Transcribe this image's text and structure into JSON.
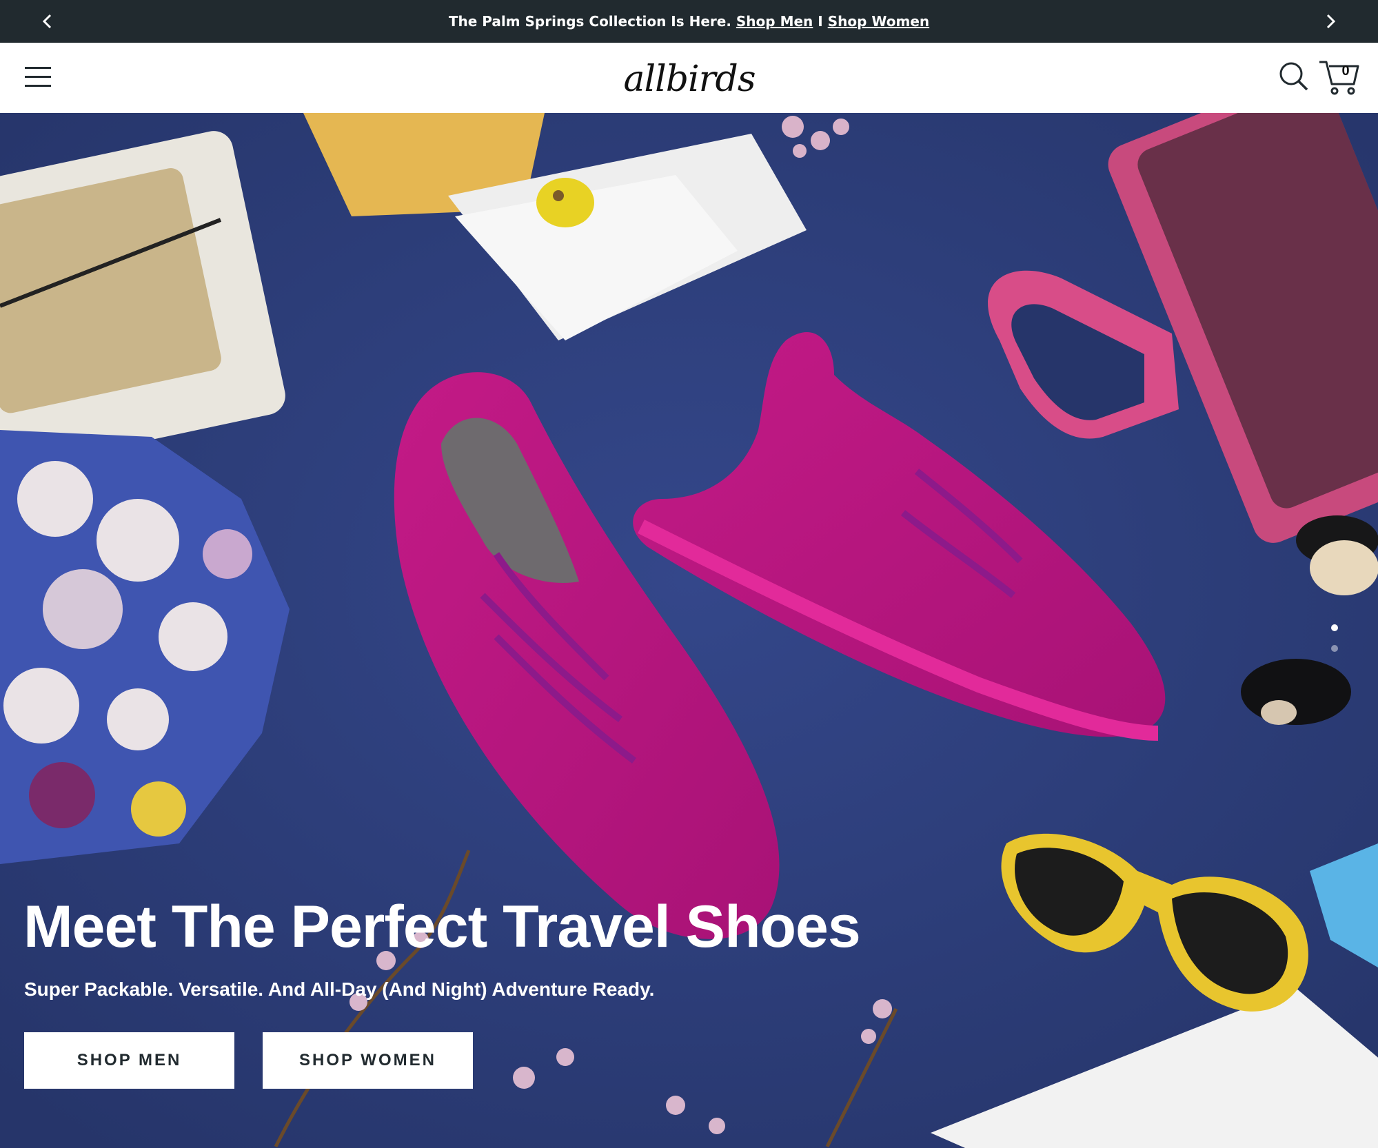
{
  "announcement": {
    "text": "The Palm Springs Collection Is Here.",
    "link_men": "Shop Men",
    "separator": "I",
    "link_women": "Shop Women",
    "prev_icon": "chevron-left-icon",
    "next_icon": "chevron-right-icon"
  },
  "header": {
    "menu_icon": "hamburger-menu-icon",
    "logo_text": "allbirds",
    "search_icon": "search-icon",
    "cart_icon": "cart-icon",
    "cart_count": "0"
  },
  "hero": {
    "title": "Meet The Perfect Travel Shoes",
    "subtitle": "Super Packable. Versatile. And All-Day (And Night) Adventure Ready.",
    "buttons": {
      "shop_men": "SHOP MEN",
      "shop_women": "SHOP WOMEN"
    },
    "carousel": {
      "slide_count": 2,
      "active_index": 1
    }
  },
  "colors": {
    "announcement_bg": "#212a2f",
    "hero_bg": "#2a3a72",
    "shoe_pink": "#c21a8c",
    "button_bg": "#ffffff",
    "button_text": "#212a2f"
  }
}
